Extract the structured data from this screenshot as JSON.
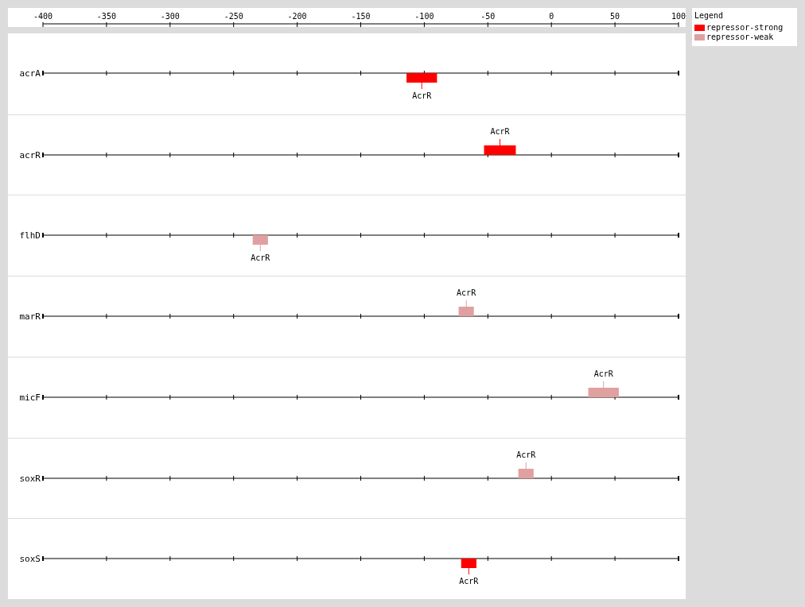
{
  "axis": {
    "ticks": [
      "-400",
      "-350",
      "-300",
      "-250",
      "-200",
      "-150",
      "-100",
      "-50",
      "0",
      "50",
      "100"
    ]
  },
  "tracks": [
    {
      "gene": "acrA",
      "sites": [
        {
          "label": "AcrR",
          "kind": "strong",
          "reverse": true
        }
      ]
    },
    {
      "gene": "acrR",
      "sites": [
        {
          "label": "AcrR",
          "kind": "strong",
          "reverse": false
        }
      ]
    },
    {
      "gene": "flhD",
      "sites": [
        {
          "label": "AcrR",
          "kind": "weak",
          "reverse": true
        }
      ]
    },
    {
      "gene": "marR",
      "sites": [
        {
          "label": "AcrR",
          "kind": "weak",
          "reverse": false
        }
      ]
    },
    {
      "gene": "micF",
      "sites": [
        {
          "label": "AcrR",
          "kind": "weak",
          "reverse": false
        }
      ]
    },
    {
      "gene": "soxR",
      "sites": [
        {
          "label": "AcrR",
          "kind": "weak",
          "reverse": false
        }
      ]
    },
    {
      "gene": "soxS",
      "sites": [
        {
          "label": "AcrR",
          "kind": "strong",
          "reverse": true
        }
      ]
    }
  ],
  "legend": {
    "title": "Legend",
    "items": [
      {
        "label": "repressor-strong",
        "kind": "strong",
        "color": "#ff0000"
      },
      {
        "label": "repressor-weak",
        "kind": "weak",
        "color": "#e0a0a0"
      }
    ]
  }
}
